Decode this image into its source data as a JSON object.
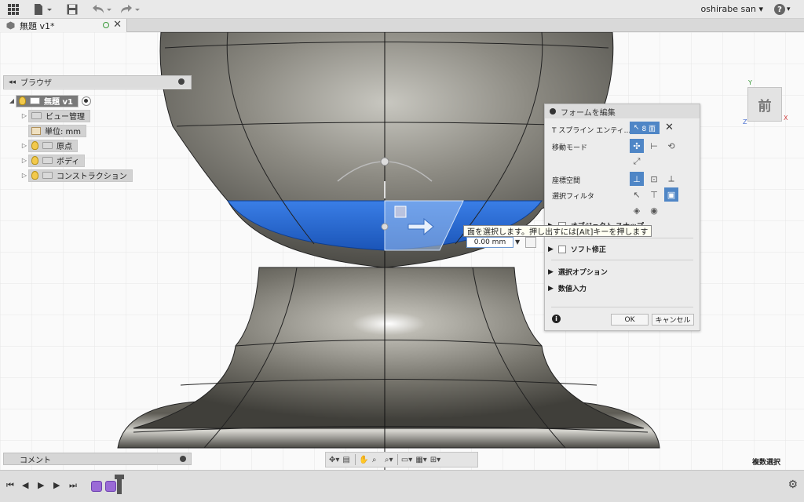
{
  "window": {
    "user": "oshirabe san",
    "help_label": "?",
    "document_tab": "無題 v1*"
  },
  "toolbar": {
    "icons": [
      "grid-icon",
      "file-icon",
      "save-icon",
      "undo-icon",
      "redo-icon"
    ]
  },
  "browser": {
    "title": "ブラウザ",
    "root": "無題 v1",
    "items": [
      {
        "label": "ビュー管理",
        "has_bulb": false
      },
      {
        "label": "単位: mm",
        "has_bulb": false
      },
      {
        "label": "原点",
        "has_bulb": true
      },
      {
        "label": "ボディ",
        "has_bulb": true
      },
      {
        "label": "コンストラクション",
        "has_bulb": true
      }
    ]
  },
  "viewcube": {
    "face": "前",
    "x": "X",
    "y": "Y",
    "z": "Z"
  },
  "edit_form": {
    "title": "フォームを編集",
    "t_spline_label": "T スプライン エンティ...",
    "selection_count": "8 面",
    "transform_mode_label": "移動モード",
    "coordinate_space_label": "座標空間",
    "selection_filter_label": "選択フィルタ",
    "object_snap_label": "オブジェクト スナップ",
    "soft_modification_label": "ソフト修正",
    "selection_options_label": "選択オプション",
    "numeric_input_label": "数値入力",
    "ok_label": "OK",
    "cancel_label": "キャンセル",
    "info_label": "i"
  },
  "manipulator": {
    "tooltip": "面を選択します。押し出すには[Alt]キーを押します",
    "value": "0.00 mm"
  },
  "comment": {
    "label": "コメント"
  },
  "status": {
    "multi_select": "複数選択"
  },
  "colors": {
    "selection_blue": "#2f6fd6",
    "accent": "#4f86c6",
    "body_metal": "#6b6a64"
  }
}
